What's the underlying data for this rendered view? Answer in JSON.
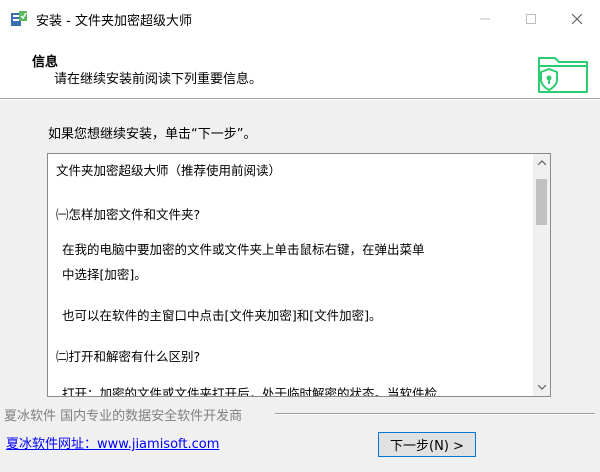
{
  "window": {
    "title": "安装 - 文件夹加密超级大师",
    "icons": {
      "app": "installer-app-icon",
      "minimize": "minimize-icon",
      "maximize": "maximize-icon",
      "close": "close-icon"
    }
  },
  "header": {
    "title": "信息",
    "subtitle": "请在继续安装前阅读下列重要信息。",
    "icon": "shield-folder-icon",
    "accent_color": "#2ecc71"
  },
  "prompt": "如果您想继续安装，单击“下一步”。",
  "readme": {
    "lines": [
      "文件夹加密超级大师（推荐使用前阅读）",
      "㈠怎样加密文件和文件夹?",
      "在我的电脑中要加密的文件或文件夹上单击鼠标右键，在弹出菜单",
      "中选择[加密]。",
      "也可以在软件的主窗口中点击[文件夹加密]和[文件加密]。",
      "㈡打开和解密有什么区别?",
      "打开：加密的文件或文件夹打开后，处于临时解密的状态。当软件检"
    ]
  },
  "footer": {
    "brand": "夏冰软件 国内专业的数据安全软件开发商",
    "link_text": "夏冰软件网址：www.jiamisoft.com",
    "next_button": "下一步(N) >"
  }
}
